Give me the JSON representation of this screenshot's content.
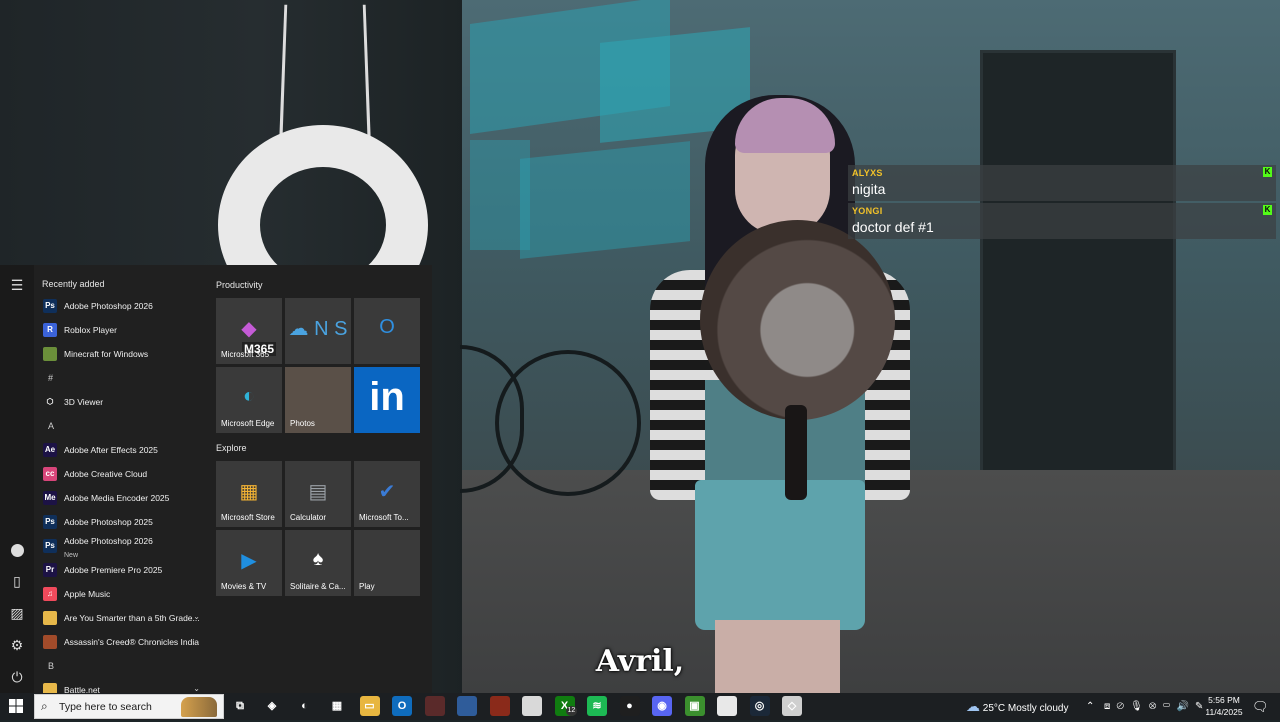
{
  "chat": [
    {
      "user": "ALYXS",
      "message": "nigita",
      "badge": "K"
    },
    {
      "user": "YONGI",
      "message": "doctor def #1",
      "badge": "K"
    }
  ],
  "subtitle": "Avril,",
  "start_menu": {
    "recently_added_title": "Recently added",
    "app_list": [
      {
        "type": "app",
        "name": "Adobe Photoshop 2026",
        "icon": "Ps",
        "color": "#0f2f5a"
      },
      {
        "type": "app",
        "name": "Roblox Player",
        "icon": "R",
        "color": "#3b63d9"
      },
      {
        "type": "app",
        "name": "Minecraft for Windows",
        "icon": "",
        "color": "#6b8f3a"
      },
      {
        "type": "letter",
        "name": "#"
      },
      {
        "type": "app",
        "name": "3D Viewer",
        "icon": "⬡",
        "color": "transparent"
      },
      {
        "type": "letter",
        "name": "A"
      },
      {
        "type": "app",
        "name": "Adobe After Effects 2025",
        "icon": "Ae",
        "color": "#1c1245"
      },
      {
        "type": "app",
        "name": "Adobe Creative Cloud",
        "icon": "cc",
        "color": "#d8457a"
      },
      {
        "type": "app",
        "name": "Adobe Media Encoder 2025",
        "icon": "Me",
        "color": "#1c1245"
      },
      {
        "type": "app",
        "name": "Adobe Photoshop 2025",
        "icon": "Ps",
        "color": "#0f2f5a"
      },
      {
        "type": "app",
        "name": "Adobe Photoshop 2026",
        "icon": "Ps",
        "color": "#0f2f5a",
        "sub": "New"
      },
      {
        "type": "app",
        "name": "Adobe Premiere Pro 2025",
        "icon": "Pr",
        "color": "#1c1245"
      },
      {
        "type": "app",
        "name": "Apple Music",
        "icon": "♫",
        "color": "#f04a5c"
      },
      {
        "type": "app",
        "name": "Are You Smarter than a 5th Grade...",
        "icon": "",
        "color": "#e7b84a",
        "chevron": true
      },
      {
        "type": "app",
        "name": "Assassin's Creed® Chronicles India",
        "icon": "",
        "color": "#a24b2a"
      },
      {
        "type": "letter",
        "name": "B"
      },
      {
        "type": "app",
        "name": "Battle.net",
        "icon": "",
        "color": "#e7b84a",
        "chevron": true
      }
    ],
    "groups": [
      {
        "title": "Productivity"
      },
      {
        "title": "Explore"
      }
    ],
    "tiles": [
      {
        "label": "Microsoft 365",
        "overlay": "M365",
        "bg": "#3a3a3a",
        "glyph": "◆",
        "glyph_color": "#c45bd6"
      },
      {
        "label": "",
        "bg": "#3a3a3a",
        "glyph": "☁ N S",
        "glyph_color": "#4aa3e0"
      },
      {
        "label": "",
        "bg": "#3a3a3a",
        "glyph": "O",
        "glyph_color": "#2f8fe0"
      },
      {
        "label": "Microsoft Edge",
        "bg": "#3a3a3a",
        "glyph": "◐",
        "glyph_color": "#2fb3d8"
      },
      {
        "label": "Photos",
        "bg": "#5a5048",
        "glyph": "",
        "glyph_color": "#fff"
      },
      {
        "label": "",
        "bg": "#0a66c2",
        "glyph": "in",
        "glyph_color": "#ffffff"
      },
      {
        "label": "Microsoft Store",
        "bg": "#3a3a3a",
        "glyph": "▦",
        "glyph_color": "#f2b233"
      },
      {
        "label": "Calculator",
        "bg": "#3a3a3a",
        "glyph": "▤",
        "glyph_color": "#9aa0a6"
      },
      {
        "label": "Microsoft To...",
        "bg": "#3a3a3a",
        "glyph": "✔",
        "glyph_color": "#3a7bd5"
      },
      {
        "label": "Movies & TV",
        "bg": "#3a3a3a",
        "glyph": "▶",
        "glyph_color": "#1f8fe0"
      },
      {
        "label": "Solitaire & Ca...",
        "bg": "#3a3a3a",
        "glyph": "♠",
        "glyph_color": "#ffffff"
      },
      {
        "label": "Play",
        "bg": "#3a3a3a",
        "glyph": "",
        "glyph_color": "#b57be0"
      }
    ]
  },
  "taskbar": {
    "search_placeholder": "Type here to search",
    "apps": [
      {
        "name": "task-view",
        "glyph": "⧉",
        "bg": "transparent"
      },
      {
        "name": "copilot",
        "glyph": "◈",
        "bg": "transparent"
      },
      {
        "name": "edge",
        "glyph": "◐",
        "bg": "transparent"
      },
      {
        "name": "store",
        "glyph": "▦",
        "bg": "transparent"
      },
      {
        "name": "file-explorer",
        "glyph": "▭",
        "bg": "#e8b640"
      },
      {
        "name": "outlook",
        "glyph": "O",
        "bg": "#0f6cbd"
      },
      {
        "name": "game-1",
        "glyph": "",
        "bg": "#5a2a2a"
      },
      {
        "name": "game-2",
        "glyph": "",
        "bg": "#2f5c9a"
      },
      {
        "name": "game-3",
        "glyph": "",
        "bg": "#8a2a1a"
      },
      {
        "name": "game-4",
        "glyph": "",
        "bg": "#d9d9d9"
      },
      {
        "name": "xbox",
        "glyph": "X",
        "bg": "#107c10"
      },
      {
        "name": "spotify",
        "glyph": "≋",
        "bg": "#1db954"
      },
      {
        "name": "obs",
        "glyph": "●",
        "bg": "#1f1f1f"
      },
      {
        "name": "discord",
        "glyph": "◉",
        "bg": "#5865f2"
      },
      {
        "name": "creeper",
        "glyph": "▣",
        "bg": "#3b8f2e"
      },
      {
        "name": "paint",
        "glyph": "",
        "bg": "#e8e8e8"
      },
      {
        "name": "steam",
        "glyph": "◎",
        "bg": "#1b2838"
      },
      {
        "name": "app-white",
        "glyph": "◇",
        "bg": "#cfcfcf"
      }
    ],
    "xbox_badge": "12",
    "weather_temp": "25°C",
    "weather_desc": "Mostly cloudy",
    "time": "5:56 PM",
    "date": "11/4/2025"
  }
}
